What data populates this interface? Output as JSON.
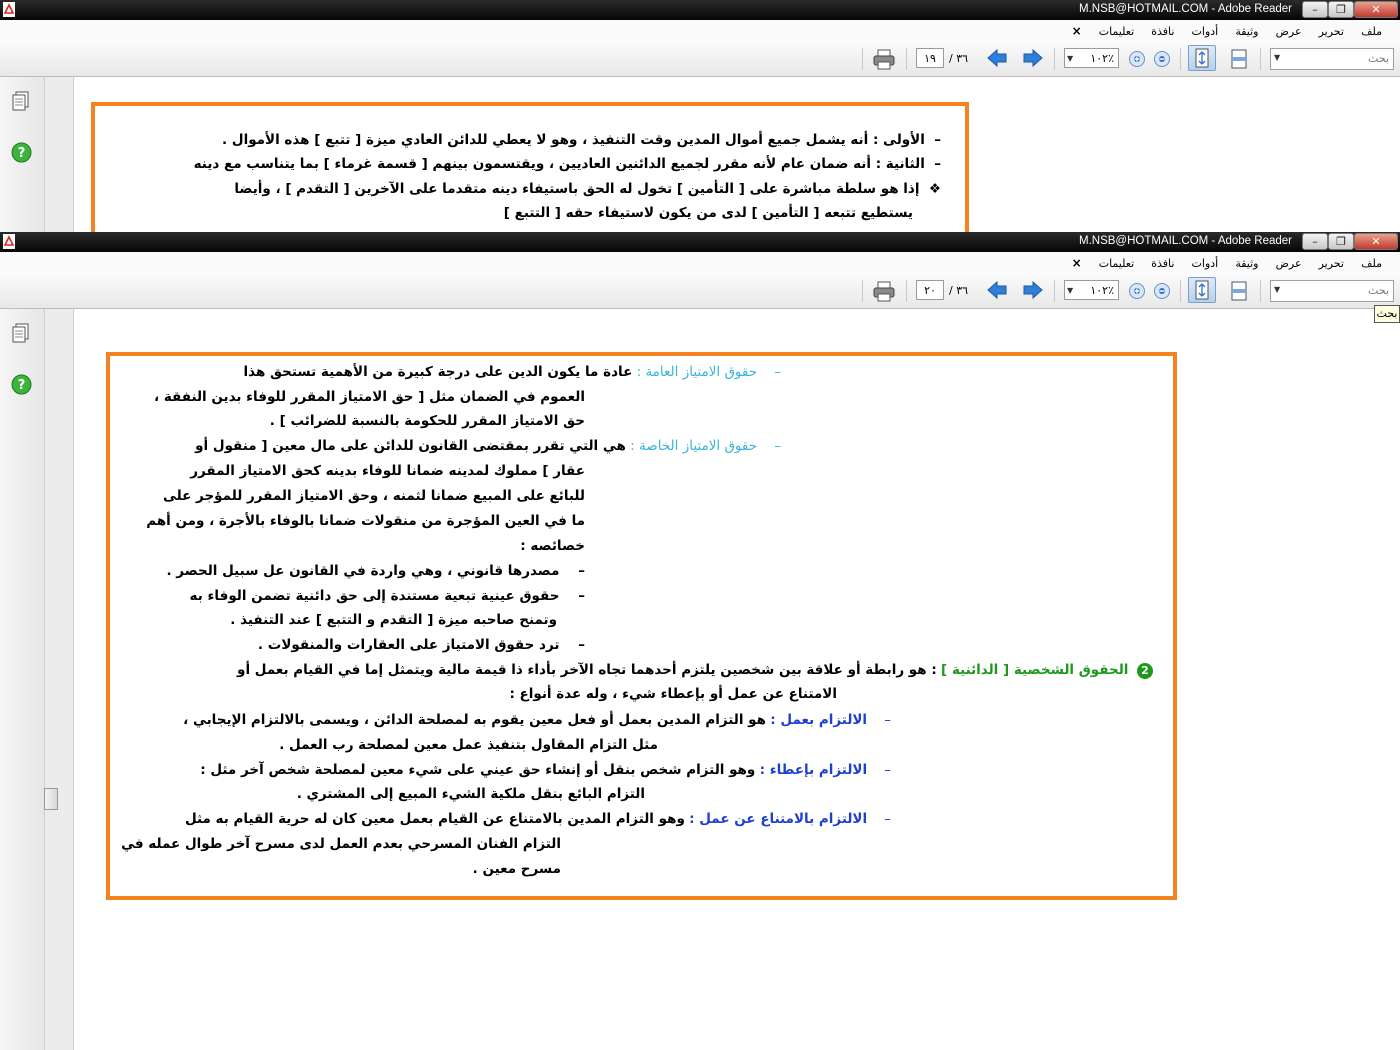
{
  "window1": {
    "title": "M.NSB@HOTMAIL.COM - Adobe Reader",
    "menu": [
      "ملف",
      "تحرير",
      "عرض",
      "وثيقة",
      "أدوات",
      "نافذة",
      "تعليمات"
    ],
    "close_doc": "×",
    "page_current": "١٩",
    "page_total": "/ ٣٦",
    "zoom": "١٠٢٪",
    "search_placeholder": "بحث",
    "lines": [
      {
        "bullet": "–",
        "text": "الأولى : أنه يشمل جميع أموال المدين وقت التنفيذ ، وهو لا يعطي للدائن العادي ميزة [ تتبع ] هذه الأموال ."
      },
      {
        "bullet": "–",
        "text": "الثانية : أنه ضمان عام لأنه مقرر لجميع الدائنين العاديين ، ويقتسمون بينهم [ قسمة غرماء ] بما يتناسب مع دينه"
      },
      {
        "bullet": "❖",
        "text": "إذا هو سلطة مباشرة على [ التأمين ] تخول له الحق باستيفاء دينه متقدما على الآخرين [ التقدم ] ، وأيضا"
      },
      {
        "bullet": "",
        "text": "يستطيع تتبعه [ التأمين ] لدى من يكون لاستيفاء حقه [ التتبع ]"
      }
    ]
  },
  "window2": {
    "title": "M.NSB@HOTMAIL.COM - Adobe Reader",
    "menu": [
      "ملف",
      "تحرير",
      "عرض",
      "وثيقة",
      "أدوات",
      "نافذة",
      "تعليمات"
    ],
    "close_doc": "×",
    "page_current": "٢٠",
    "page_total": "/ ٣٦",
    "zoom": "١٠٢٪",
    "search_placeholder": "بحث",
    "tooltip": "بحث",
    "content": {
      "l1_bullet": "–",
      "l1_head": "حقوق الامتياز العامة :",
      "l1_text": "عادة ما يكون الدين على درجة كبيرة من الأهمية تستحق هذا",
      "l2": "العموم في الضمان مثل [ حق الامتياز المقرر للوفاء بدين النفقة ،",
      "l3": "حق الامتياز المقرر للحكومة بالنسبة للضرائب ] .",
      "l4_bullet": "–",
      "l4_head": "حقوق الامتياز الخاصة :",
      "l4_text": "هي التي تقرر بمقتضى القانون للدائن على مال معين [ منقول أو",
      "l5": "عقار ] مملوك لمدينه ضمانا للوفاء بدينه كحق الامتياز المقرر",
      "l6": "للبائع على المبيع ضمانا لثمنه ، وحق الامتياز المقرر للمؤجر على",
      "l7": "ما في العين المؤجرة من منقولات ضمانا بالوفاء بالأجرة ، ومن أهم",
      "l8": "خصائصه :",
      "l9_bullet": "–",
      "l9": "مصدرها قانوني ، وهي واردة في القانون عل سبيل الحصر .",
      "l10_bullet": "–",
      "l10": "حقوق عينية تبعية مستندة إلى حق دائنية تضمن الوفاء به",
      "l11": "وتمنح صاحبه ميزة [ التقدم و التتبع ] عند التنفيذ .",
      "l12_bullet": "–",
      "l12": "ترد حقوق الامتياز على العقارات والمنقولات .",
      "l13_num": "2",
      "l13_head": "الحقوق الشخصية [ الدائنية ]",
      "l13_text": ": هو رابطة أو علاقة بين شخصين يلتزم أحدهما تجاه الآخر بأداء ذا قيمة مالية ويتمثل إما في القيام بعمل أو",
      "l14": "الامتناع عن عمل أو بإعطاء شيء ، وله عدة أنواع :",
      "l15_bullet": "–",
      "l15_head": "الالتزام بعمل :",
      "l15_text": "هو التزام المدين بعمل أو فعل معين يقوم به لمصلحة الدائن ، ويسمى بالالتزام الإيجابي ،",
      "l16": "مثل التزام المقاول بتنفيذ عمل معين لمصلحة رب العمل .",
      "l17_bullet": "–",
      "l17_head": "الالتزام بإعطاء :",
      "l17_text": "وهو التزام شخص بنقل أو إنشاء حق عيني على شيء معين لمصلحة شخص آخر مثل :",
      "l18": "التزام البائع بنقل ملكية الشيء المبيع إلى المشتري .",
      "l19_bullet": "–",
      "l19_head": "الالتزام بالامتناع عن عمل :",
      "l19_text": "وهو التزام المدين بالامتناع عن القيام بعمل معين كان له حرية القيام به مثل",
      "l20": "التزام الفنان المسرحي بعدم العمل لدى مسرح آخر طوال عمله في",
      "l21": "مسرح معين ."
    }
  },
  "colors": {
    "accent_border": "#f58220",
    "heading_cyan": "#3ab6d4",
    "heading_blue": "#1f3fd0",
    "heading_green": "#1d9a1d"
  }
}
